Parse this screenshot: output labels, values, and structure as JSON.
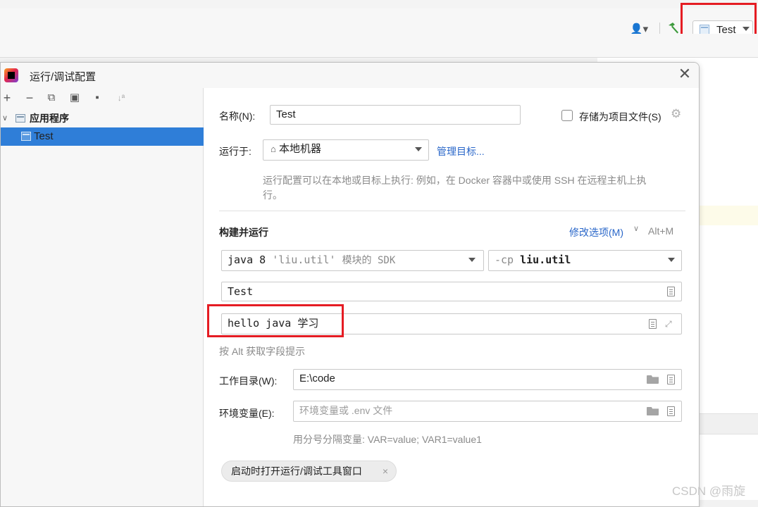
{
  "toolbar": {
    "config_label": "Test"
  },
  "dialog": {
    "title": "运行/调试配置",
    "close_glyph": "✕"
  },
  "left": {
    "toolbar": [
      "+",
      "−",
      "⧉",
      "▣",
      "▪",
      "↓ª"
    ],
    "tree_group_label": "应用程序",
    "tree_item_label": "Test"
  },
  "form": {
    "name_label": "名称(N):",
    "name_value": "Test",
    "store_as_file_label": "存储为项目文件(S)",
    "run_on_label": "运行于:",
    "run_on_value": "本地机器",
    "manage_targets_link": "管理目标...",
    "run_on_hint_line1": "运行配置可以在本地或目标上执行: 例如，在 Docker 容器中或使用 SSH 在远程主机上执",
    "run_on_hint_line2": "行。",
    "build_run_heading": "构建并运行",
    "modify_options_link": "修改选项(M)",
    "modify_options_shortcut": "Alt+M",
    "sdk_java": "java 8",
    "sdk_module": "'liu.util'",
    "sdk_suffix": "模块的 SDK",
    "cp_prefix": "-cp",
    "cp_value": "liu.util",
    "main_class_value": "Test",
    "program_args_value": "hello java 学习",
    "alt_hint": "按 Alt 获取字段提示",
    "workdir_label": "工作目录(W):",
    "workdir_value": "E:\\code",
    "env_label": "环境变量(E):",
    "env_placeholder": "环境变量或 .env 文件",
    "env_hint": "用分号分隔变量: VAR=value; VAR1=value1",
    "open_tool_window_chip": "启动时打开运行/调试工具窗口",
    "chip_close": "×"
  },
  "watermark": "CSDN @雨旋",
  "colors": {
    "accent": "#2f7ed8",
    "link": "#2a67c9",
    "highlight_box": "#e51c23"
  }
}
